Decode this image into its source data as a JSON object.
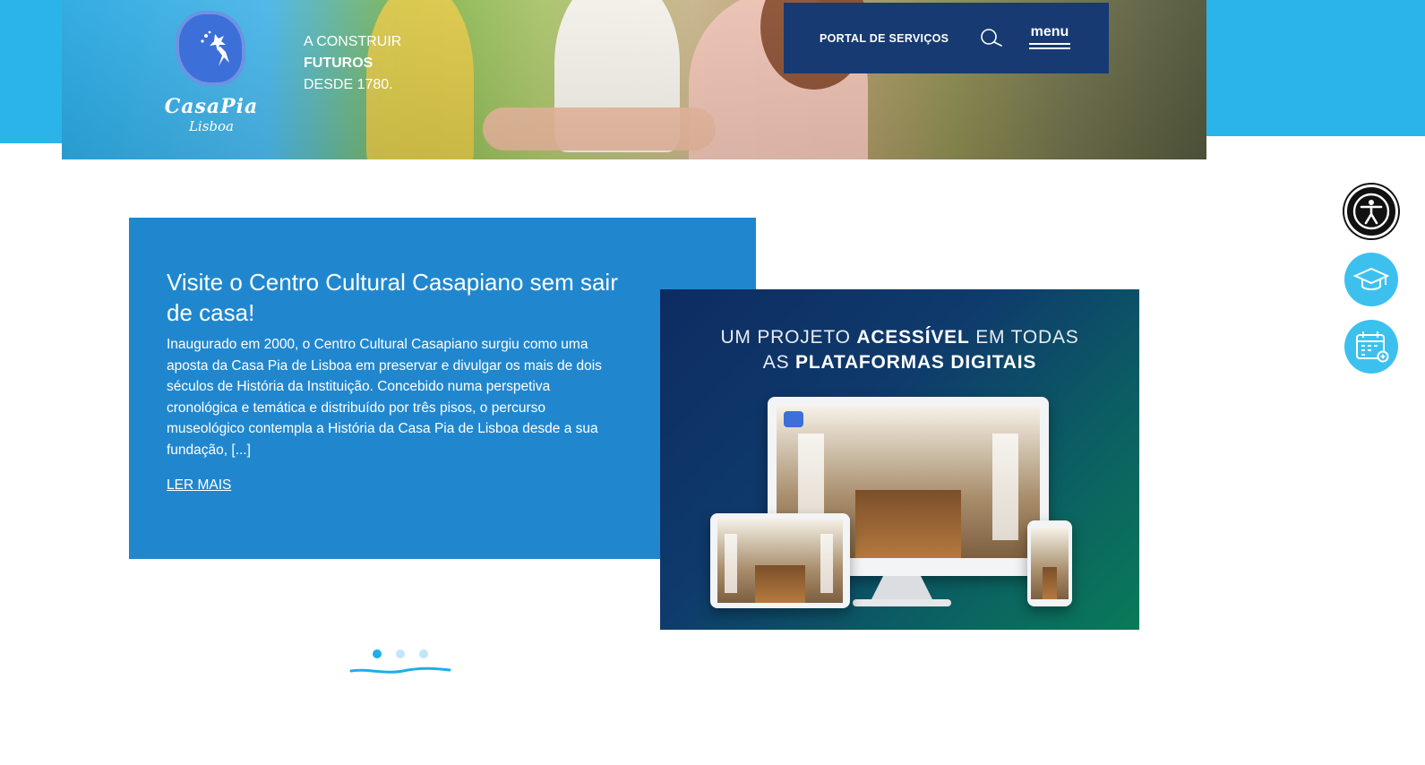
{
  "header": {
    "logo": {
      "name": "CasaPia",
      "city": "Lisboa"
    },
    "tagline": {
      "line1": "A CONSTRUIR",
      "line2": "FUTUROS",
      "line3": "DESDE 1780."
    },
    "nav": {
      "portal_label": "PORTAL DE SERVIÇOS",
      "menu_label": "menu",
      "search_icon": "search-icon"
    }
  },
  "feature": {
    "title": "Visite o Centro Cultural Casapiano sem sair de casa!",
    "body": "Inaugurado em 2000, o Centro Cultural Casapiano surgiu como uma aposta da Casa Pia de Lisboa em preservar e divulgar os mais de dois séculos de História da Instituição. Concebido numa perspetiva cronológica e temática e distribuído por três pisos, o percurso museológico contempla a História da Casa Pia de Lisboa desde a sua fundação, [...]",
    "link_label": "LER MAIS"
  },
  "promo": {
    "line1_normal_a": "UM PROJETO ",
    "line1_bold": "ACESSÍVEL",
    "line1_normal_b": " EM TODAS",
    "line2_normal": "AS ",
    "line2_bold": "PLATAFORMAS DIGITAIS"
  },
  "slider": {
    "count": 3,
    "active_index": 0
  },
  "side_buttons": [
    {
      "icon": "accessibility-icon"
    },
    {
      "icon": "graduation-cap-icon"
    },
    {
      "icon": "calendar-icon"
    }
  ],
  "colors": {
    "brand_blue": "#2ab4ea",
    "nav_navy": "#173a73",
    "card_blue": "#2087cf",
    "dot_active": "#1eaee8",
    "dot_inactive": "#bfe7f7"
  }
}
